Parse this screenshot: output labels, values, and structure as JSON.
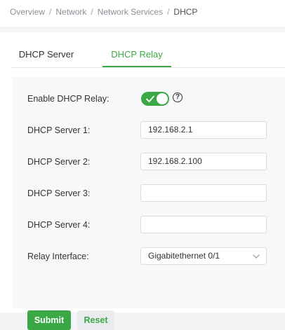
{
  "breadcrumb": {
    "items": [
      "Overview",
      "Network",
      "Network Services",
      "DHCP"
    ],
    "separator": "/"
  },
  "tabs": [
    {
      "label": "DHCP Server",
      "active": false
    },
    {
      "label": "DHCP Relay",
      "active": true
    }
  ],
  "form": {
    "enable_label": "Enable DHCP Relay:",
    "enable_value": true,
    "help_glyph": "?",
    "server1_label": "DHCP Server 1:",
    "server1_value": "192.168.2.1",
    "server2_label": "DHCP Server 2:",
    "server2_value": "192.168.2.100",
    "server3_label": "DHCP Server 3:",
    "server3_value": "",
    "server4_label": "DHCP Server 4:",
    "server4_value": "",
    "interface_label": "Relay Interface:",
    "interface_value": "Gigabitethernet 0/1"
  },
  "buttons": {
    "submit": "Submit",
    "reset": "Reset"
  },
  "colors": {
    "accent": "#3aa845"
  },
  "icons": {
    "toggle": "check-icon",
    "help": "question-circle-icon",
    "select": "chevron-down-icon"
  }
}
